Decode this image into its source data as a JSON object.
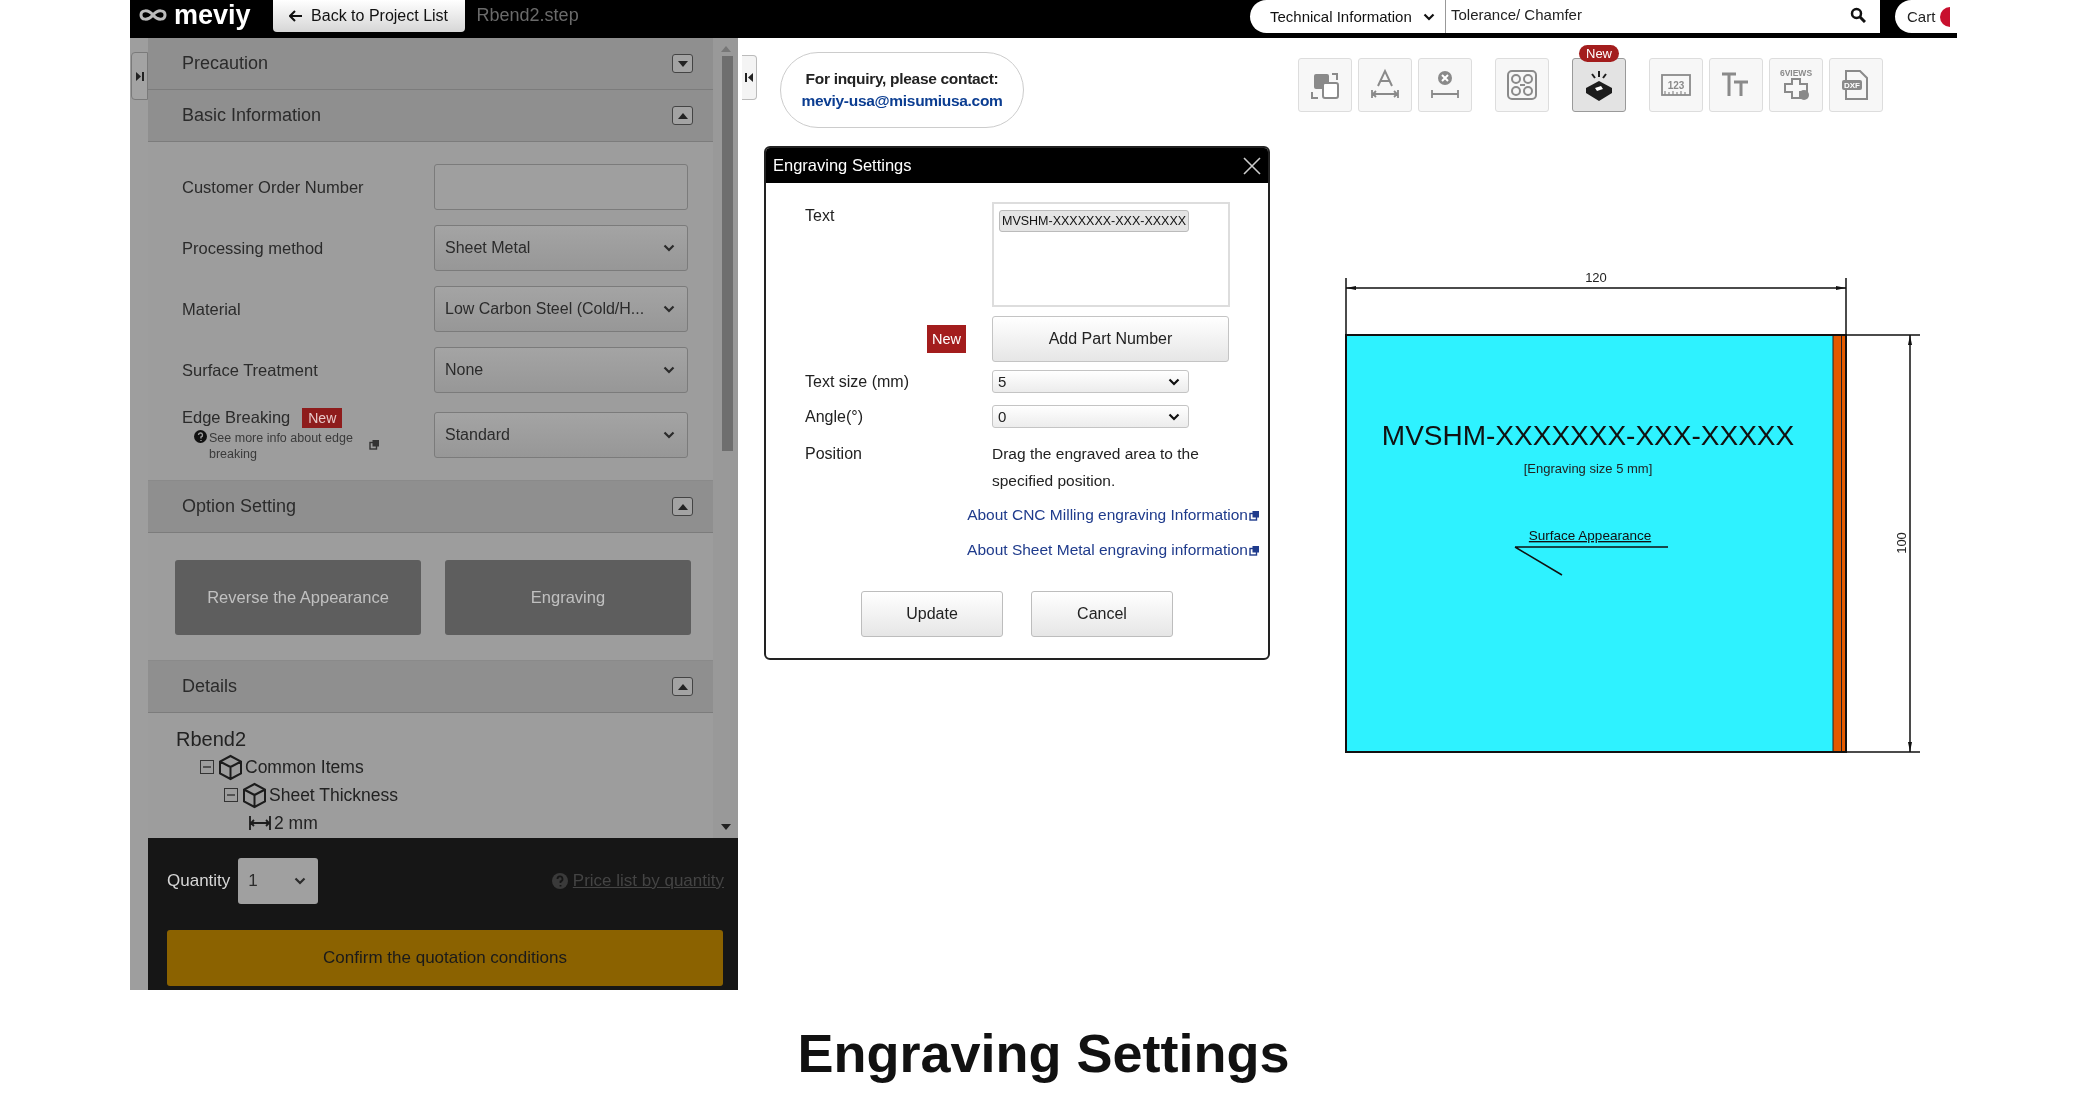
{
  "header": {
    "logo": "meviy",
    "back_button": "Back to Project List",
    "file_name": "Rbend2.step",
    "category_select": "Technical Information",
    "search": {
      "value": "Tolerance/ Chamfer"
    },
    "cart": "Cart"
  },
  "sidebar": {
    "sections": [
      {
        "kind": "plain",
        "title": "Precaution",
        "expanded": false
      },
      {
        "kind": "form",
        "title": "Basic Information",
        "expanded": true,
        "fields": [
          {
            "kind": "input",
            "label": "Customer Order Number"
          },
          {
            "kind": "select",
            "label": "Processing method",
            "value": "Sheet Metal"
          },
          {
            "kind": "select",
            "label": "Material",
            "value": "Low Carbon Steel (Cold/H..."
          },
          {
            "kind": "select",
            "label": "Surface Treatment",
            "value": "None"
          },
          {
            "kind": "select",
            "label": "Edge Breaking",
            "badge": "New",
            "help": "See more info about edge breaking",
            "value": "Standard"
          }
        ]
      },
      {
        "kind": "options",
        "title": "Option Setting",
        "expanded": true,
        "buttons": [
          {
            "label": "Reverse the Appearance",
            "disabled": true
          },
          {
            "label": "Engraving",
            "disabled": true
          }
        ]
      },
      {
        "kind": "tree",
        "title": "Details",
        "expanded": true,
        "root": "Rbend2",
        "children": [
          {
            "kind": "group",
            "label": "Common Items",
            "expanded": true,
            "children": [
              {
                "kind": "group",
                "label": "Sheet Thickness",
                "expanded": true,
                "children": [
                  {
                    "kind": "value",
                    "label": "2 mm"
                  }
                ]
              }
            ]
          }
        ]
      }
    ]
  },
  "order": {
    "quantity_label": "Quantity",
    "quantity": "1",
    "price_link": "Price list by quantity",
    "confirm_button": "Confirm the quotation conditions"
  },
  "contact": {
    "line1": "For inquiry, please contact:",
    "email": "meviy-usa@misumiusa.com"
  },
  "toolbar": [
    {
      "selected": false
    },
    {
      "selected": false
    },
    {
      "selected": false
    },
    {
      "selected": false
    },
    {
      "selected": true,
      "badge": "New"
    },
    {
      "selected": false,
      "label": "123"
    },
    {
      "selected": false
    },
    {
      "selected": false,
      "label": "6VIEWS"
    },
    {
      "selected": false,
      "label": "DXF"
    }
  ],
  "dialog": {
    "title": "Engraving Settings",
    "text_label": "Text",
    "text_chip": "MVSHM-XXXXXXX-XXX-XXXXX",
    "badge": "New",
    "add_button": "Add Part Number",
    "text_size": {
      "label": "Text size (mm)",
      "value": "5"
    },
    "angle": {
      "label": "Angle(°)",
      "value": "0"
    },
    "position": {
      "label": "Position",
      "hint": "Drag the engraved area to the specified position."
    },
    "links": [
      "About CNC Milling engraving Information",
      "About Sheet Metal engraving information"
    ],
    "buttons": [
      "Update",
      "Cancel"
    ]
  },
  "drawing": {
    "width_dim": "120",
    "height_dim": "100",
    "engraving_text": "MVSHM-XXXXXXX-XXX-XXXXX",
    "size_note": "[Engraving size 5 mm]",
    "surface_label": "Surface Appearance"
  },
  "caption": "Engraving Settings"
}
